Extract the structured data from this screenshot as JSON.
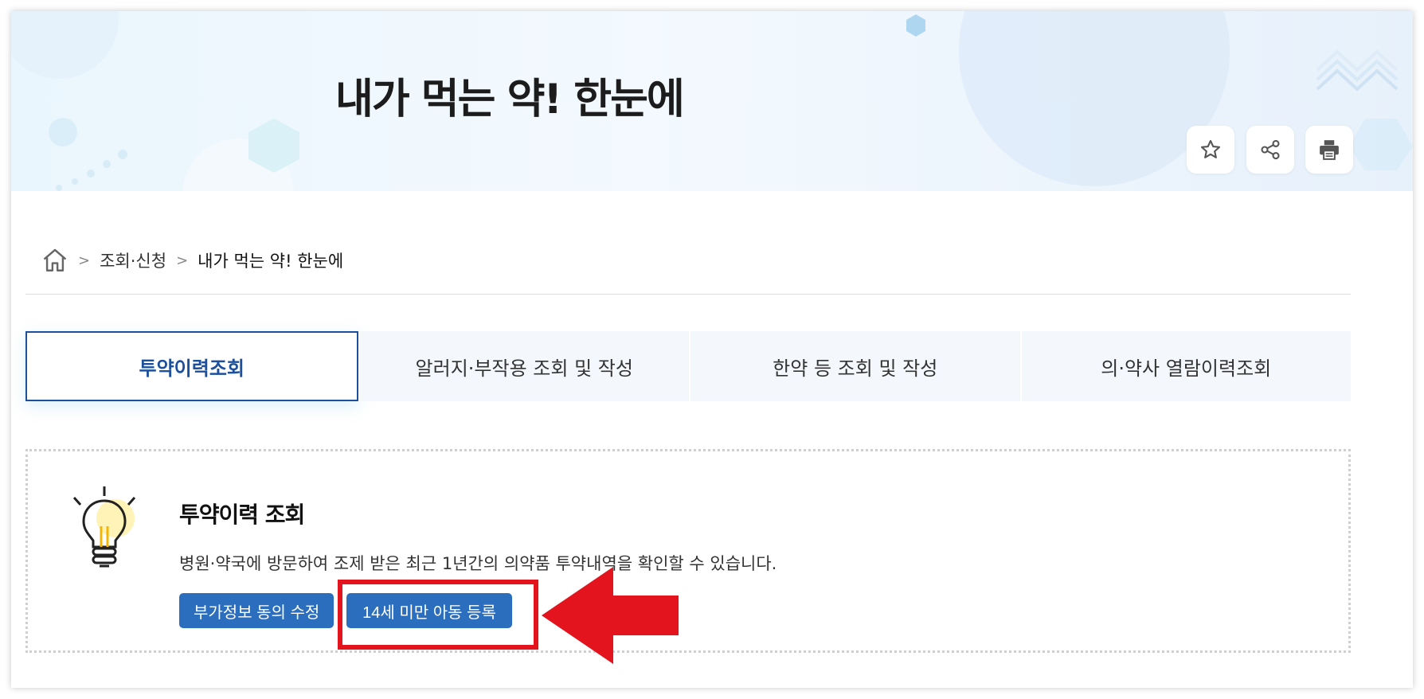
{
  "header": {
    "title": "내가 먹는 약! 한눈에",
    "tools": {
      "favorite": "star-icon",
      "share": "share-icon",
      "print": "printer-icon"
    }
  },
  "breadcrumb": {
    "home_icon": "home-icon",
    "items": [
      "조회·신청",
      "내가 먹는 약! 한눈에"
    ]
  },
  "tabs": [
    {
      "label": "투약이력조회",
      "active": true
    },
    {
      "label": "알러지·부작용 조회 및 작성",
      "active": false
    },
    {
      "label": "한약 등 조회 및 작성",
      "active": false
    },
    {
      "label": "의·약사 열람이력조회",
      "active": false
    }
  ],
  "info": {
    "icon": "lightbulb-icon",
    "title": "투약이력 조회",
    "description": "병원·약국에 방문하여 조제 받은 최근 1년간의 의약품 투약내역을 확인할 수 있습니다.",
    "buttons": {
      "consent": "부가정보 동의 수정",
      "register_child": "14세 미만 아동 등록"
    }
  },
  "colors": {
    "accent": "#1c4f9c",
    "button": "#2a6ebd",
    "highlight": "#e3141d"
  }
}
